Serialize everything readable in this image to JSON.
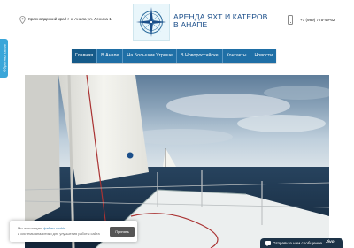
{
  "header": {
    "address": "Краснодарский край г-к. Анапа ул. Ленина 1",
    "brand_title": "АРЕНДА ЯХТ И КАТЕРОВ В АНАПЕ",
    "phone": "+7 (989) 775-49-62"
  },
  "side_tab": {
    "label": "Обратная связь"
  },
  "nav": {
    "items": [
      {
        "label": "Главная"
      },
      {
        "label": "В Анапе"
      },
      {
        "label": "На Большом Утрише"
      },
      {
        "label": "В Новороссийске"
      },
      {
        "label": "Контакты"
      },
      {
        "label": "Новости"
      }
    ]
  },
  "cookie": {
    "line1_prefix": "Мы используем",
    "line1_link": "файлы cookie",
    "line2": "и системы аналитики для улучшения работы сайта",
    "accept_label": "Принять"
  },
  "chat": {
    "label": "Отправьте нам сообщение",
    "brand": "Jivo"
  },
  "colors": {
    "nav": "#1f6fa6",
    "brand_text": "#1c4f8a",
    "side_tab": "#3aa6d9",
    "chat": "#1d3347"
  },
  "icons": [
    "location-pin-icon",
    "compass-rose-logo",
    "phone-icon",
    "chat-icon"
  ]
}
